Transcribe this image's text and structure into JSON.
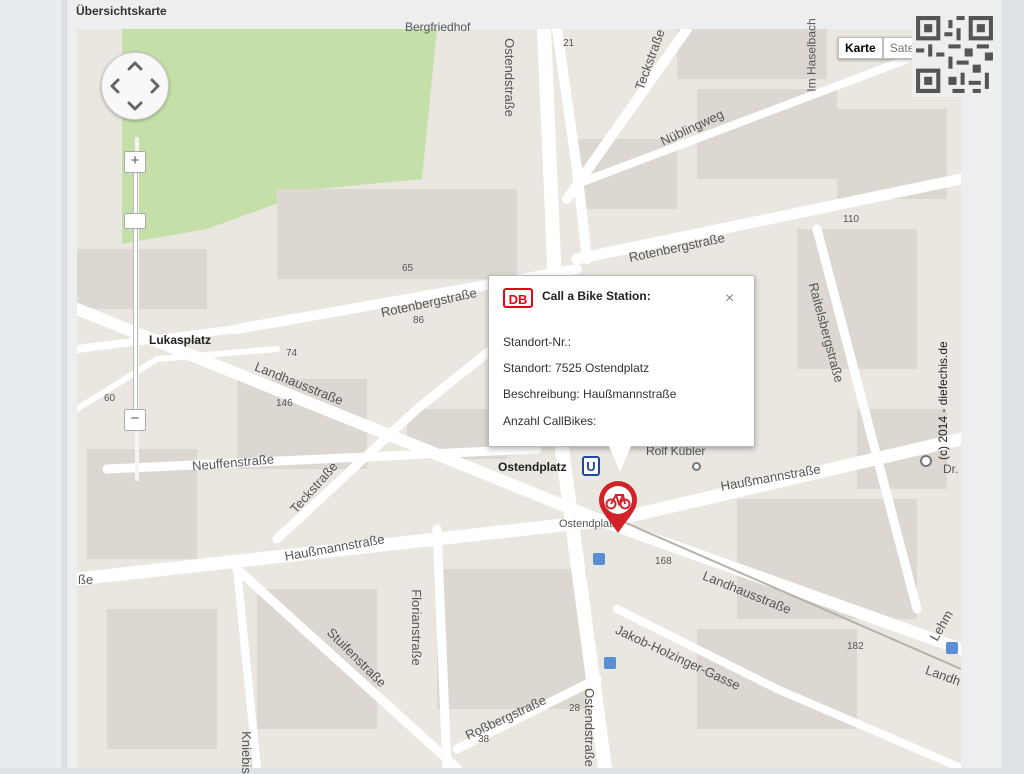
{
  "panel": {
    "title": "Übersichtskarte"
  },
  "map": {
    "map_type_active": "Karte",
    "map_type_inactive": "Satellit",
    "copyright": "(c) 2014 - diefechis.de",
    "zoom_in": "+",
    "zoom_out": "−",
    "labels": {
      "berg": "Bergfriedhof",
      "ostendstrasse_top": "Ostendstraße",
      "num21": "21",
      "teckstrasse_top": "Teckstraße",
      "im_haselbach": "Im Haselbach",
      "nueblingweg": "Nüblingweg",
      "num110": "110",
      "rotenberg_right": "Rotenbergstraße",
      "num65": "65",
      "rotenberg_left": "Rotenbergstraße",
      "num86": "86",
      "lukasplatz": "Lukasplatz",
      "num74": "74",
      "landhaus_left": "Landhausstraße",
      "num146": "146",
      "num60": "60",
      "raitelsberg": "Raitelsbergstraße",
      "neuffen": "Neuffenstraße",
      "teckstrasse_bottom": "Teckstraße",
      "ostendplatz_stop": "Ostendplatz",
      "rolf_kuebler": "Rolf Kübler",
      "haussmann_right": "Haußmannstraße",
      "ostendplatz_small": "Ostendplatz",
      "haussmann_left": "Haußmannstraße",
      "sse": "ße",
      "num168": "168",
      "landhaus_right": "Landhausstraße",
      "floriansstrasse": "Florianstraße",
      "stuifen": "Stuifenstraße",
      "jakob_holzinger": "Jakob-Holzinger-Gasse",
      "num182": "182",
      "rossberg": "Roßbergstraße",
      "num38": "38",
      "ostendstrasse_bottom": "Ostendstraße",
      "num28": "28",
      "kniebis": "Kniebis",
      "lehmgruben": "Lehm",
      "landhaus_edge": "Landh",
      "dr": "Dr.",
      "c_circle": "C"
    }
  },
  "popup": {
    "logo": "DB",
    "title": "Call a Bike Station:",
    "close": "×",
    "standort_nr": "Standort-Nr.:",
    "standort": "Standort: 7525 Ostendplatz",
    "beschreibung": "Beschreibung: Haußmannstraße",
    "anzahl": "Anzahl CallBikes:"
  },
  "colors": {
    "map_bg": "#eae7e1",
    "road": "#ffffff",
    "park": "#c5dfa8",
    "building": "#dcd8d1",
    "marker": "#d2232a",
    "db_red": "#e30613"
  }
}
